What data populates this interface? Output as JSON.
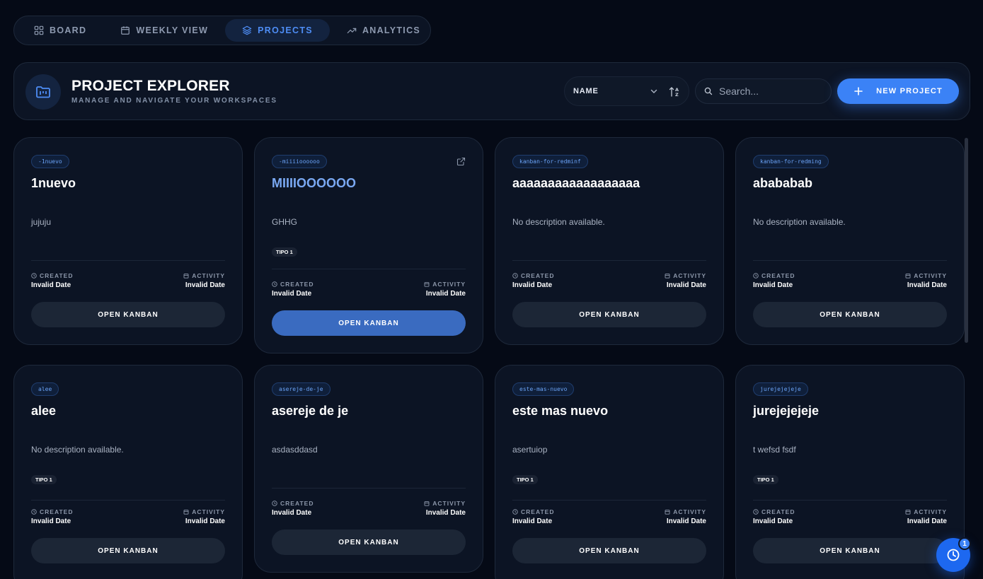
{
  "nav": {
    "tabs": [
      {
        "label": "BOARD",
        "icon": "grid-icon",
        "active": false
      },
      {
        "label": "WEEKLY VIEW",
        "icon": "calendar-icon",
        "active": false
      },
      {
        "label": "PROJECTS",
        "icon": "layers-icon",
        "active": true
      },
      {
        "label": "ANALYTICS",
        "icon": "trend-up-icon",
        "active": false
      }
    ]
  },
  "header": {
    "title": "PROJECT EXPLORER",
    "subtitle": "MANAGE AND NAVIGATE YOUR WORKSPACES",
    "icon": "folder-kanban-icon",
    "sort": {
      "selected": "NAME",
      "toggle_icon": "sort-az-icon"
    },
    "search": {
      "placeholder": "Search...",
      "value": ""
    },
    "new_button_label": "NEW PROJECT"
  },
  "card_labels": {
    "created": "CREATED",
    "activity": "ACTIVITY",
    "open": "OPEN KANBAN"
  },
  "projects": [
    {
      "slug": "-1nuevo",
      "title": "1nuevo",
      "description": "jujuju",
      "tag": "",
      "created": "Invalid Date",
      "activity": "Invalid Date"
    },
    {
      "slug": "-miiiioooooo",
      "title": "MIIIIOOOOOO",
      "description": "GHHG",
      "tag": "TIPO 1",
      "created": "Invalid Date",
      "activity": "Invalid Date",
      "highlighted": true
    },
    {
      "slug": "kanban-for-redminf",
      "title": "aaaaaaaaaaaaaaaaaa",
      "description": "No description available.",
      "tag": "",
      "created": "Invalid Date",
      "activity": "Invalid Date"
    },
    {
      "slug": "kanban-for-redming",
      "title": "abababab",
      "description": "No description available.",
      "tag": "",
      "created": "Invalid Date",
      "activity": "Invalid Date"
    },
    {
      "slug": "alee",
      "title": "alee",
      "description": "No description available.",
      "tag": "TIPO 1",
      "created": "Invalid Date",
      "activity": "Invalid Date"
    },
    {
      "slug": "asereje-de-je",
      "title": "asereje de je",
      "description": "asdasddasd",
      "tag": "",
      "created": "Invalid Date",
      "activity": "Invalid Date"
    },
    {
      "slug": "este-mas-nuevo",
      "title": "este mas nuevo",
      "description": "asertuiop",
      "tag": "TIPO 1",
      "created": "Invalid Date",
      "activity": "Invalid Date"
    },
    {
      "slug": "jurejejejeje",
      "title": "jurejejejeje",
      "description": "t wefsd fsdf",
      "tag": "TIPO 1",
      "created": "Invalid Date",
      "activity": "Invalid Date"
    }
  ],
  "history_fab": {
    "badge": "1",
    "icon": "clock-icon"
  },
  "colors": {
    "background": "#050a16",
    "panel": "#0c1424",
    "accent": "#3b82f6",
    "card_highlight": "#3a6bc0"
  }
}
